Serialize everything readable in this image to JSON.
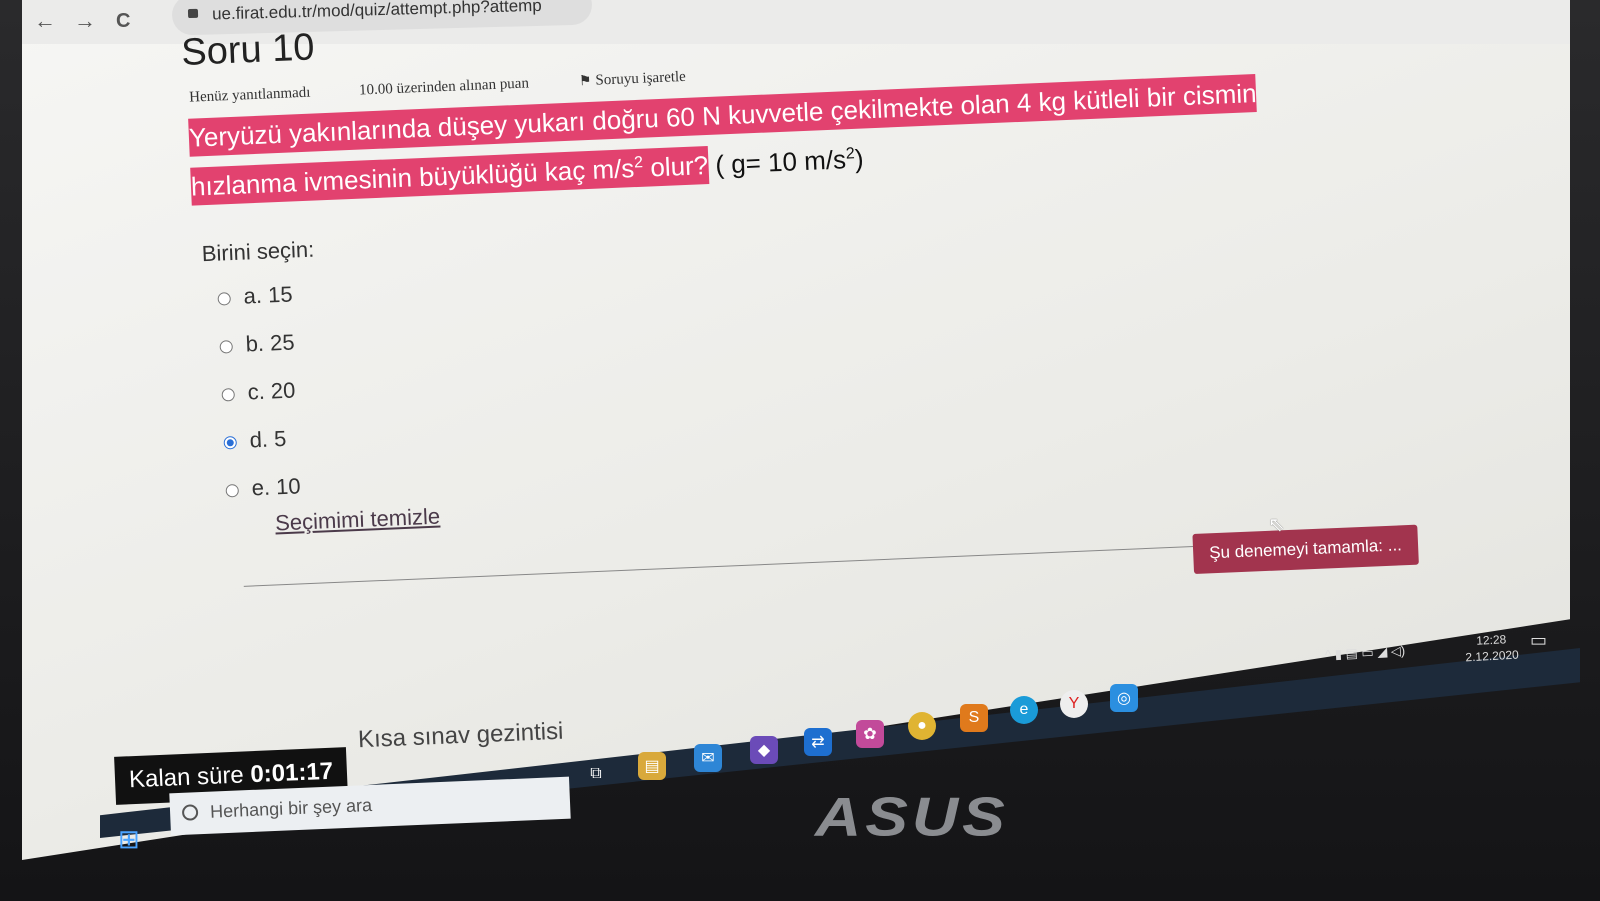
{
  "browser": {
    "url": "ue.firat.edu.tr/mod/quiz/attempt.php?attemp",
    "back_icon": "←",
    "forward_icon": "→",
    "reload_icon": "C"
  },
  "question": {
    "title": "Soru 10",
    "status": "Henüz yanıtlanmadı",
    "points": "10.00 üzerinden alınan puan",
    "flag_label": "Soruyu işaretle",
    "text_part1": "Yeryüzü yakınlarında düşey yukarı doğru 60 N kuvvetle çekilmekte olan 4 kg kütleli bir cismin hızlanma ivmesinin büyüklüğü kaç m/s",
    "text_sup1": "2",
    "text_part2": " olur?",
    "given_part1": " ( g= 10 m/s",
    "given_sup": "2",
    "given_part2": ")",
    "prompt": "Birini seçin:",
    "options": [
      {
        "label": "a. 15",
        "selected": false
      },
      {
        "label": "b. 25",
        "selected": false
      },
      {
        "label": "c. 20",
        "selected": false
      },
      {
        "label": "d. 5",
        "selected": true
      },
      {
        "label": "e. 10",
        "selected": false
      }
    ],
    "clear_label": "Seçimimi temizle"
  },
  "finish_button": "Şu denemeyi tamamla: ...",
  "timer": {
    "label": "Kalan süre",
    "value": "0:01:17"
  },
  "quiz_nav_label": "Kısa sınav gezintisi",
  "taskbar": {
    "search_placeholder": "Herhangi bir şey ara",
    "time": "12:28",
    "date": "2.12.2020",
    "icons": [
      "task-view",
      "file-explorer",
      "mail",
      "visual-studio",
      "teamviewer",
      "photos",
      "chrome",
      "sublime-text",
      "edge",
      "yandex",
      "app"
    ]
  },
  "laptop_brand": "ASUS",
  "colors": {
    "highlight": "#e2426f",
    "finish_button": "#a2344e",
    "radio_selected": "#2a6fd6"
  }
}
